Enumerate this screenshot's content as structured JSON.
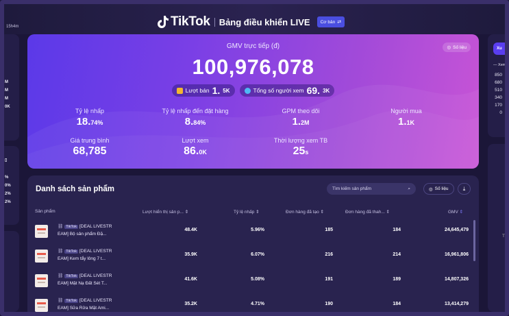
{
  "timer": "15h4m",
  "header": {
    "brand": "TikTok",
    "title": "Bảng điều khiển LIVE",
    "badge": "Cơ bản"
  },
  "gmv": {
    "label": "GMV trực tiếp (đ)",
    "value": "100,976,078",
    "data_button": "Số liệu",
    "sales_label": "Lượt bán",
    "sales_value": "1.",
    "sales_unit": "5K",
    "viewers_label": "Tổng số người xem",
    "viewers_value": "69.",
    "viewers_unit": "3K"
  },
  "stats": [
    {
      "label": "Tỷ lệ nhấp",
      "value": "18.",
      "unit": "74%"
    },
    {
      "label": "Tỷ lệ nhấp đến đặt hàng",
      "value": "8.",
      "unit": "84%"
    },
    {
      "label": "GPM theo dõi",
      "value": "1.",
      "unit": "2M"
    },
    {
      "label": "Người mua",
      "value": "1.",
      "unit": "1K"
    },
    {
      "label": "Giá trung bình",
      "value": "68,785",
      "unit": ""
    },
    {
      "label": "Lượt xem",
      "value": "86.",
      "unit": "0K"
    },
    {
      "label": "Thời lượng xem TB",
      "value": "25",
      "unit": "s"
    }
  ],
  "products": {
    "title": "Danh sách sản phẩm",
    "search_placeholder": "Tìm kiếm sản phẩm",
    "data_button": "Số liệu",
    "columns": [
      "Sản phẩm",
      "Lượt hiển thị sản p...",
      "Tỷ lệ nhấp",
      "Đơn hàng đã tạo",
      "Đơn hàng đã thah...",
      "GMV"
    ],
    "rows": [
      {
        "tag": "TikTok",
        "line1": "[DEAL LIVESTR",
        "line2": "EAM] Bộ sản phẩm Đặ...",
        "impr": "48.4K",
        "ctr": "5.96%",
        "created": "185",
        "paid": "184",
        "gmv": "24,645,479"
      },
      {
        "tag": "TikTok",
        "line1": "[DEAL LIVESTR",
        "line2": "EAM] Kem tẩy lông 7 t...",
        "impr": "35.9K",
        "ctr": "6.07%",
        "created": "216",
        "paid": "214",
        "gmv": "16,961,806"
      },
      {
        "tag": "TikTok",
        "line1": "[DEAL LIVESTR",
        "line2": "EAM] Mặt Nạ Đất Sét T...",
        "impr": "41.6K",
        "ctr": "5.08%",
        "created": "191",
        "paid": "189",
        "gmv": "14,807,326"
      },
      {
        "tag": "TikTok",
        "line1": "[DEAL LIVESTR",
        "line2": "EAM] Sữa Rửa Mặt Ami...",
        "impr": "35.2K",
        "ctr": "4.71%",
        "created": "190",
        "paid": "184",
        "gmv": "13,414,279"
      }
    ]
  },
  "left_numbers": [
    "M",
    "M",
    "M",
    "0K",
    "%",
    "0%",
    "2%",
    "2%"
  ],
  "right_panel": {
    "button": "Xu",
    "legend": "— Xem",
    "values": [
      "850",
      "680",
      "510",
      "340",
      "170",
      "0"
    ],
    "letter": "T"
  }
}
